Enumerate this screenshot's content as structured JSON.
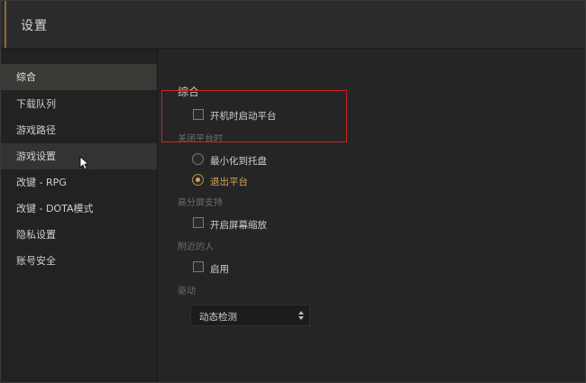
{
  "window": {
    "title": "设置"
  },
  "sidebar": {
    "items": [
      {
        "label": "综合"
      },
      {
        "label": "下载队列"
      },
      {
        "label": "游戏路径"
      },
      {
        "label": "游戏设置"
      },
      {
        "label": "改键 - RPG"
      },
      {
        "label": "改键 - DOTA模式"
      },
      {
        "label": "隐私设置"
      },
      {
        "label": "账号安全"
      }
    ]
  },
  "main": {
    "section_title": "综合",
    "startup_checkbox": {
      "label": "开机时启动平台",
      "checked": false
    },
    "close_group": {
      "label": "关闭平台时",
      "options": [
        {
          "label": "最小化到托盘",
          "selected": false
        },
        {
          "label": "退出平台",
          "selected": true
        }
      ]
    },
    "hidpi_group": {
      "label": "高分屏支持",
      "checkbox": {
        "label": "开启屏幕缩放",
        "checked": false
      }
    },
    "nearby_group": {
      "label": "附近的人",
      "checkbox": {
        "label": "启用",
        "checked": false
      }
    },
    "driver_group": {
      "label": "驱动",
      "select_value": "动态检测"
    }
  },
  "colors": {
    "accent_gold": "#d9a653",
    "highlight_red": "#d32020",
    "background": "#252525",
    "sidebar_active": "#3b3936"
  }
}
